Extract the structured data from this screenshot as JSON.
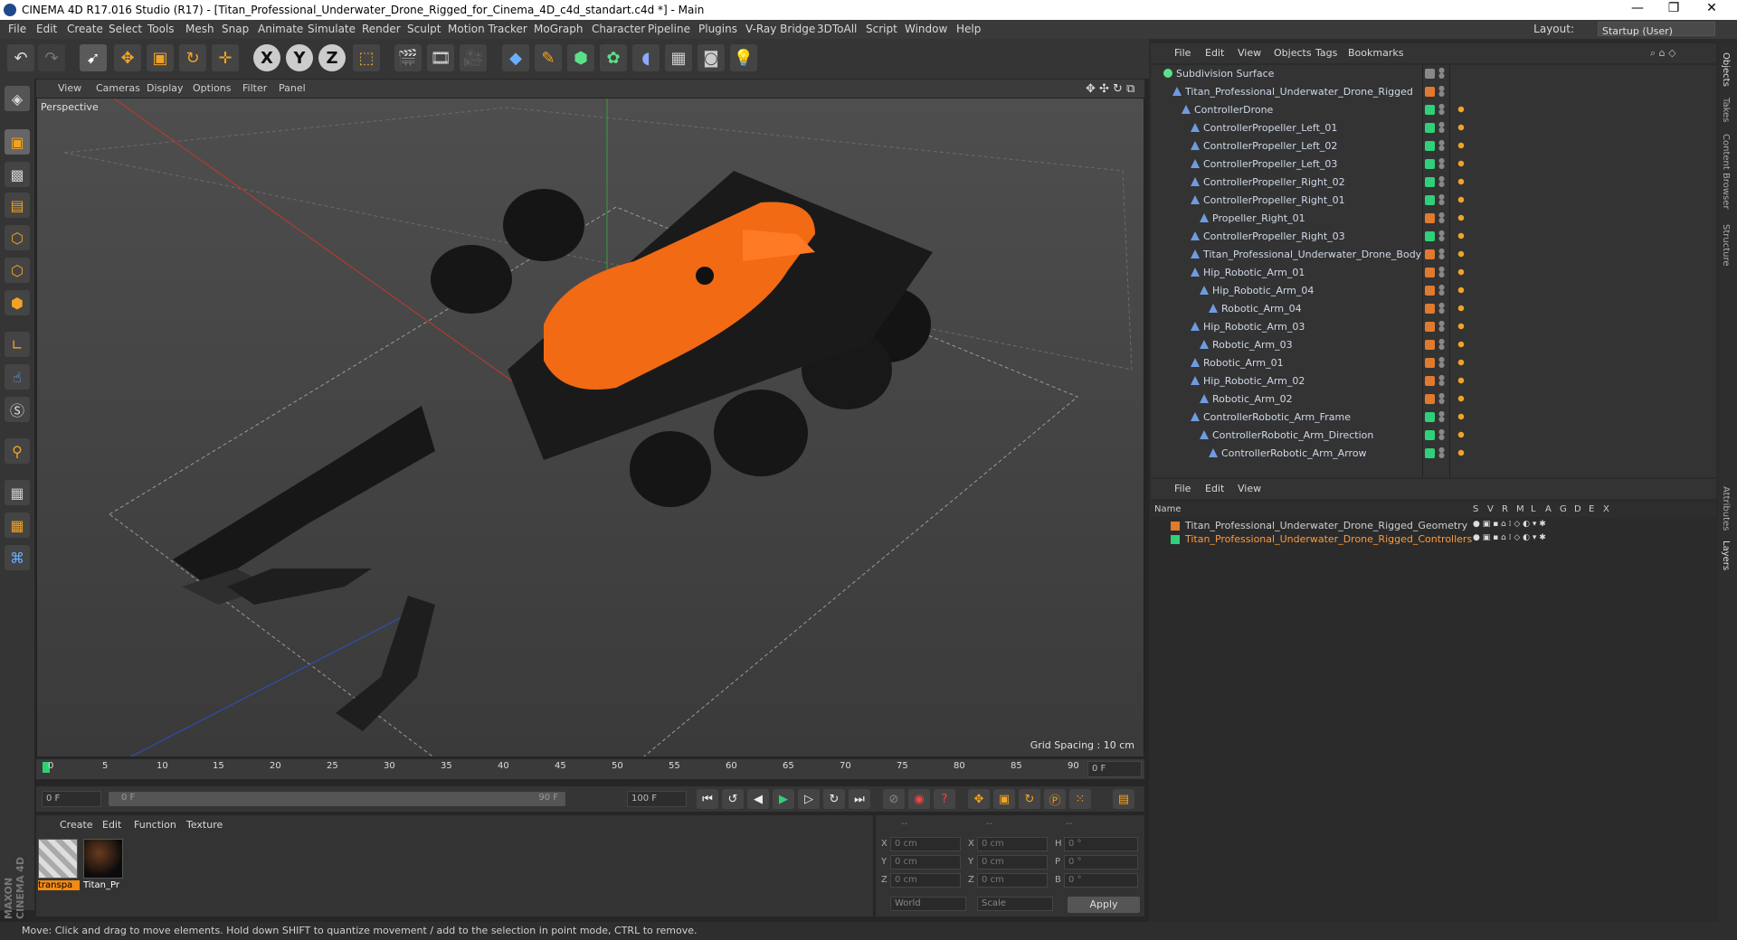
{
  "window": {
    "title": "CINEMA 4D R17.016 Studio (R17) - [Titan_Professional_Underwater_Drone_Rigged_for_Cinema_4D_c4d_standart.c4d *] - Main",
    "minimize": "—",
    "maximize": "❐",
    "close": "✕"
  },
  "menubar": {
    "items": [
      "File",
      "Edit",
      "Create",
      "Select",
      "Tools",
      "Mesh",
      "Snap",
      "Animate",
      "Simulate",
      "Render",
      "Sculpt",
      "Motion Tracker",
      "MoGraph",
      "Character",
      "Pipeline",
      "Plugins",
      "V-Ray Bridge",
      "3DToAll",
      "Script",
      "Window",
      "Help"
    ],
    "layout_label": "Layout:",
    "layout_value": "Startup (User)"
  },
  "toolbar": {
    "undo": "↶",
    "redo": "↷",
    "x_axis": "X",
    "y_axis": "Y",
    "z_axis": "Z"
  },
  "viewport": {
    "menu": [
      "View",
      "Cameras",
      "Display",
      "Options",
      "Filter",
      "Panel"
    ],
    "label": "Perspective",
    "grid_spacing": "Grid Spacing : 10 cm"
  },
  "timeline": {
    "ticks": [
      "0",
      "5",
      "10",
      "15",
      "20",
      "25",
      "30",
      "35",
      "40",
      "45",
      "50",
      "55",
      "60",
      "65",
      "70",
      "75",
      "80",
      "85",
      "90"
    ],
    "current_frame": "0 F",
    "start_field": "0 F",
    "range_start": "0 F",
    "range_end": "90 F",
    "end_field": "100 F"
  },
  "material_manager": {
    "menu": [
      "Create",
      "Edit",
      "Function",
      "Texture"
    ],
    "materials": [
      {
        "label": "transpa"
      },
      {
        "label": "Titan_Pr"
      }
    ]
  },
  "coordinates": {
    "headers": [
      "--",
      "--",
      "--"
    ],
    "rows": [
      {
        "a": "X",
        "av": "0 cm",
        "b": "X",
        "bv": "0 cm",
        "c": "H",
        "cv": "0 °"
      },
      {
        "a": "Y",
        "av": "0 cm",
        "b": "Y",
        "bv": "0 cm",
        "c": "P",
        "cv": "0 °"
      },
      {
        "a": "Z",
        "av": "0 cm",
        "b": "Z",
        "bv": "0 cm",
        "c": "B",
        "cv": "0 °"
      }
    ],
    "world": "World",
    "scale": "Scale",
    "apply": "Apply"
  },
  "object_manager": {
    "menu": [
      "File",
      "Edit",
      "View",
      "Objects",
      "Tags",
      "Bookmarks"
    ],
    "objects": [
      {
        "name": "Subdivision Surface",
        "indent": 0,
        "color": "#888888"
      },
      {
        "name": "Titan_Professional_Underwater_Drone_Rigged",
        "indent": 1,
        "color": "#e07a2e"
      },
      {
        "name": "ControllerDrone",
        "indent": 2,
        "color": "#2fd07a"
      },
      {
        "name": "ControllerPropeller_Left_01",
        "indent": 3,
        "color": "#2fd07a"
      },
      {
        "name": "ControllerPropeller_Left_02",
        "indent": 3,
        "color": "#2fd07a"
      },
      {
        "name": "ControllerPropeller_Left_03",
        "indent": 3,
        "color": "#2fd07a"
      },
      {
        "name": "ControllerPropeller_Right_02",
        "indent": 3,
        "color": "#2fd07a"
      },
      {
        "name": "ControllerPropeller_Right_01",
        "indent": 3,
        "color": "#2fd07a"
      },
      {
        "name": "Propeller_Right_01",
        "indent": 4,
        "color": "#e07a2e"
      },
      {
        "name": "ControllerPropeller_Right_03",
        "indent": 3,
        "color": "#2fd07a"
      },
      {
        "name": "Titan_Professional_Underwater_Drone_Body",
        "indent": 3,
        "color": "#e07a2e"
      },
      {
        "name": "Hip_Robotic_Arm_01",
        "indent": 3,
        "color": "#e07a2e"
      },
      {
        "name": "Hip_Robotic_Arm_04",
        "indent": 4,
        "color": "#e07a2e"
      },
      {
        "name": "Robotic_Arm_04",
        "indent": 5,
        "color": "#e07a2e"
      },
      {
        "name": "Hip_Robotic_Arm_03",
        "indent": 3,
        "color": "#e07a2e"
      },
      {
        "name": "Robotic_Arm_03",
        "indent": 4,
        "color": "#e07a2e"
      },
      {
        "name": "Robotic_Arm_01",
        "indent": 3,
        "color": "#e07a2e"
      },
      {
        "name": "Hip_Robotic_Arm_02",
        "indent": 3,
        "color": "#e07a2e"
      },
      {
        "name": "Robotic_Arm_02",
        "indent": 4,
        "color": "#e07a2e"
      },
      {
        "name": "ControllerRobotic_Arm_Frame",
        "indent": 3,
        "color": "#2fd07a"
      },
      {
        "name": "ControllerRobotic_Arm_Direction",
        "indent": 4,
        "color": "#2fd07a"
      },
      {
        "name": "ControllerRobotic_Arm_Arrow",
        "indent": 5,
        "color": "#2fd07a"
      }
    ]
  },
  "layer_manager": {
    "menu": [
      "File",
      "Edit",
      "View"
    ],
    "columns": [
      "Name",
      "S",
      "V",
      "R",
      "M",
      "L",
      "A",
      "G",
      "D",
      "E",
      "X"
    ],
    "layers": [
      {
        "name": "Titan_Professional_Underwater_Drone_Rigged_Geometry",
        "color": "#e07a2e"
      },
      {
        "name": "Titan_Professional_Underwater_Drone_Rigged_Controllers",
        "color": "#2fd07a"
      }
    ]
  },
  "side_tabs": [
    "Objects",
    "Takes",
    "Content Browser",
    "Structure",
    "Attributes",
    "Layers"
  ],
  "status": "Move: Click and drag to move elements. Hold down SHIFT to quantize movement / add to the selection in point mode, CTRL to remove.",
  "brand": "MAXON CINEMA 4D"
}
